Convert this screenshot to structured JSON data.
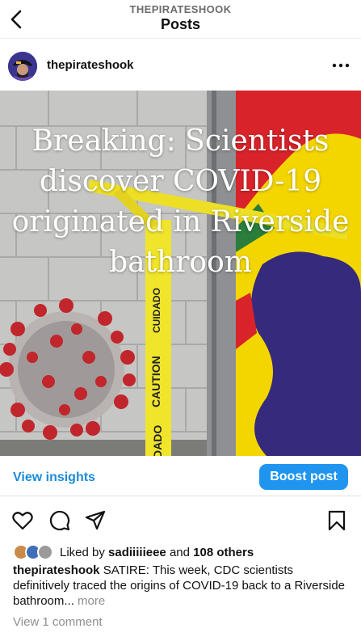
{
  "header": {
    "username": "THEPIRATESHOOK",
    "title": "Posts"
  },
  "post": {
    "username": "thepirateshook",
    "headline": "Breaking: Scientists discover COVID-19 originated in Riverside bathroom",
    "tape_text_1": "CUIDADO",
    "tape_text_2": "CAUTION",
    "tape_text_3": "DADO"
  },
  "insights": {
    "view_label": "View insights",
    "boost_label": "Boost post"
  },
  "likes": {
    "prefix": "Liked by",
    "user": "sadiiiiieee",
    "joiner": "and",
    "others": "108 others"
  },
  "caption": {
    "username": "thepirateshook",
    "text": "SATIRE: This week, CDC scientists definitively traced the origins of COVID-19 back to a Riverside bathroom...",
    "more_label": "more"
  },
  "comments_label": "View 1 comment",
  "colors": {
    "accent": "#1f95f0",
    "link": "#1a8cd8",
    "muted": "#8e8e8e"
  },
  "icons": [
    "back-icon",
    "more-dots-icon",
    "heart-icon",
    "comment-icon",
    "share-icon",
    "bookmark-icon"
  ]
}
